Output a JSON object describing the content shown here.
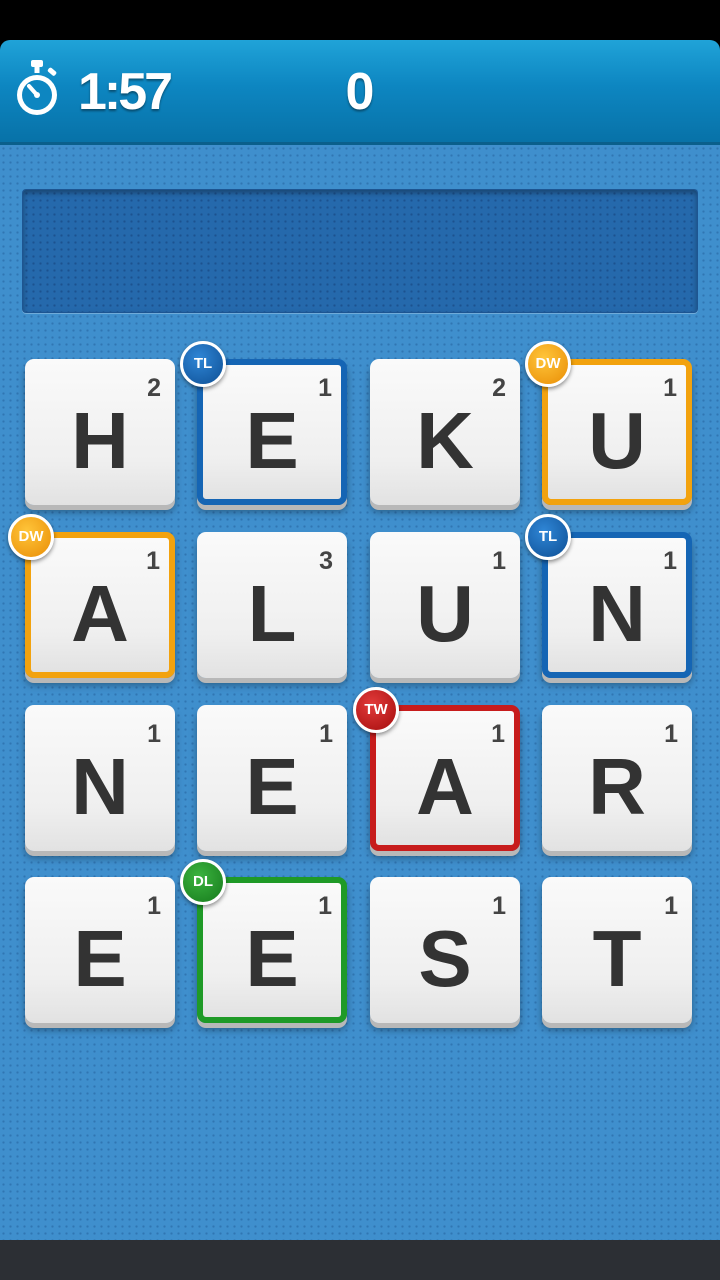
{
  "header": {
    "timer": "1:57",
    "score": "0",
    "timer_icon": "stopwatch-icon",
    "accent": "#0d86c1"
  },
  "current_word": "",
  "board_color": "#3f8fcd",
  "bonus_colors": {
    "TL": "#1565b4",
    "DW": "#f2a20e",
    "TW": "#c71c1c",
    "DL": "#1f9a27"
  },
  "tiles": [
    {
      "letter": "H",
      "points": "2",
      "bonus": ""
    },
    {
      "letter": "E",
      "points": "1",
      "bonus": "TL"
    },
    {
      "letter": "K",
      "points": "2",
      "bonus": ""
    },
    {
      "letter": "U",
      "points": "1",
      "bonus": "DW"
    },
    {
      "letter": "A",
      "points": "1",
      "bonus": "DW"
    },
    {
      "letter": "L",
      "points": "3",
      "bonus": ""
    },
    {
      "letter": "U",
      "points": "1",
      "bonus": ""
    },
    {
      "letter": "N",
      "points": "1",
      "bonus": "TL"
    },
    {
      "letter": "N",
      "points": "1",
      "bonus": ""
    },
    {
      "letter": "E",
      "points": "1",
      "bonus": ""
    },
    {
      "letter": "A",
      "points": "1",
      "bonus": "TW"
    },
    {
      "letter": "R",
      "points": "1",
      "bonus": ""
    },
    {
      "letter": "E",
      "points": "1",
      "bonus": ""
    },
    {
      "letter": "E",
      "points": "1",
      "bonus": "DL"
    },
    {
      "letter": "S",
      "points": "1",
      "bonus": ""
    },
    {
      "letter": "T",
      "points": "1",
      "bonus": ""
    }
  ]
}
